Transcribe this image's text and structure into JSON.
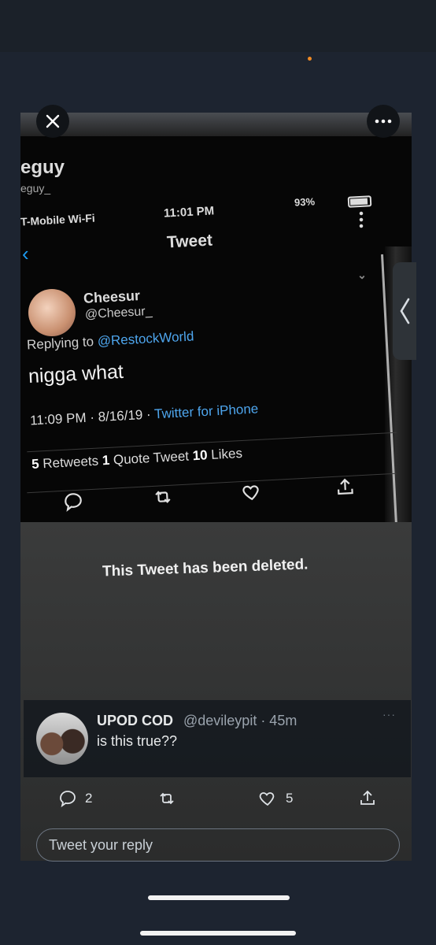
{
  "photo": {
    "bg_account_name": "eguy",
    "bg_account_handle": "eguy_",
    "status_carrier": "T-Mobile Wi-Fi",
    "status_time": "11:01 PM",
    "status_battery": "93%",
    "header_title": "Tweet",
    "tweet": {
      "author_name": "Cheesur",
      "author_handle": "@Cheesur_",
      "replying_prefix": "Replying to ",
      "replying_to": "@RestockWorld",
      "body": "nigga what",
      "timestamp": "11:09 PM · 8/16/19 · ",
      "source": "Twitter for iPhone",
      "retweets_count": "5",
      "retweets_label": " Retweets ",
      "quotes_count": "1",
      "quotes_label": " Quote Tweet ",
      "likes_count": "10",
      "likes_label": " Likes"
    },
    "deleted_notice": "This Tweet has been deleted."
  },
  "reply": {
    "name": "UPOD COD",
    "handle": "@devileypit · 45m",
    "more": "···",
    "text": "is this true??"
  },
  "actions": {
    "reply_count": "2",
    "like_count": "5"
  },
  "composer": {
    "placeholder": "Tweet your reply"
  },
  "colors": {
    "background": "#1d2430",
    "link_blue": "#4ea6ee",
    "text": "#e7e9ea"
  }
}
